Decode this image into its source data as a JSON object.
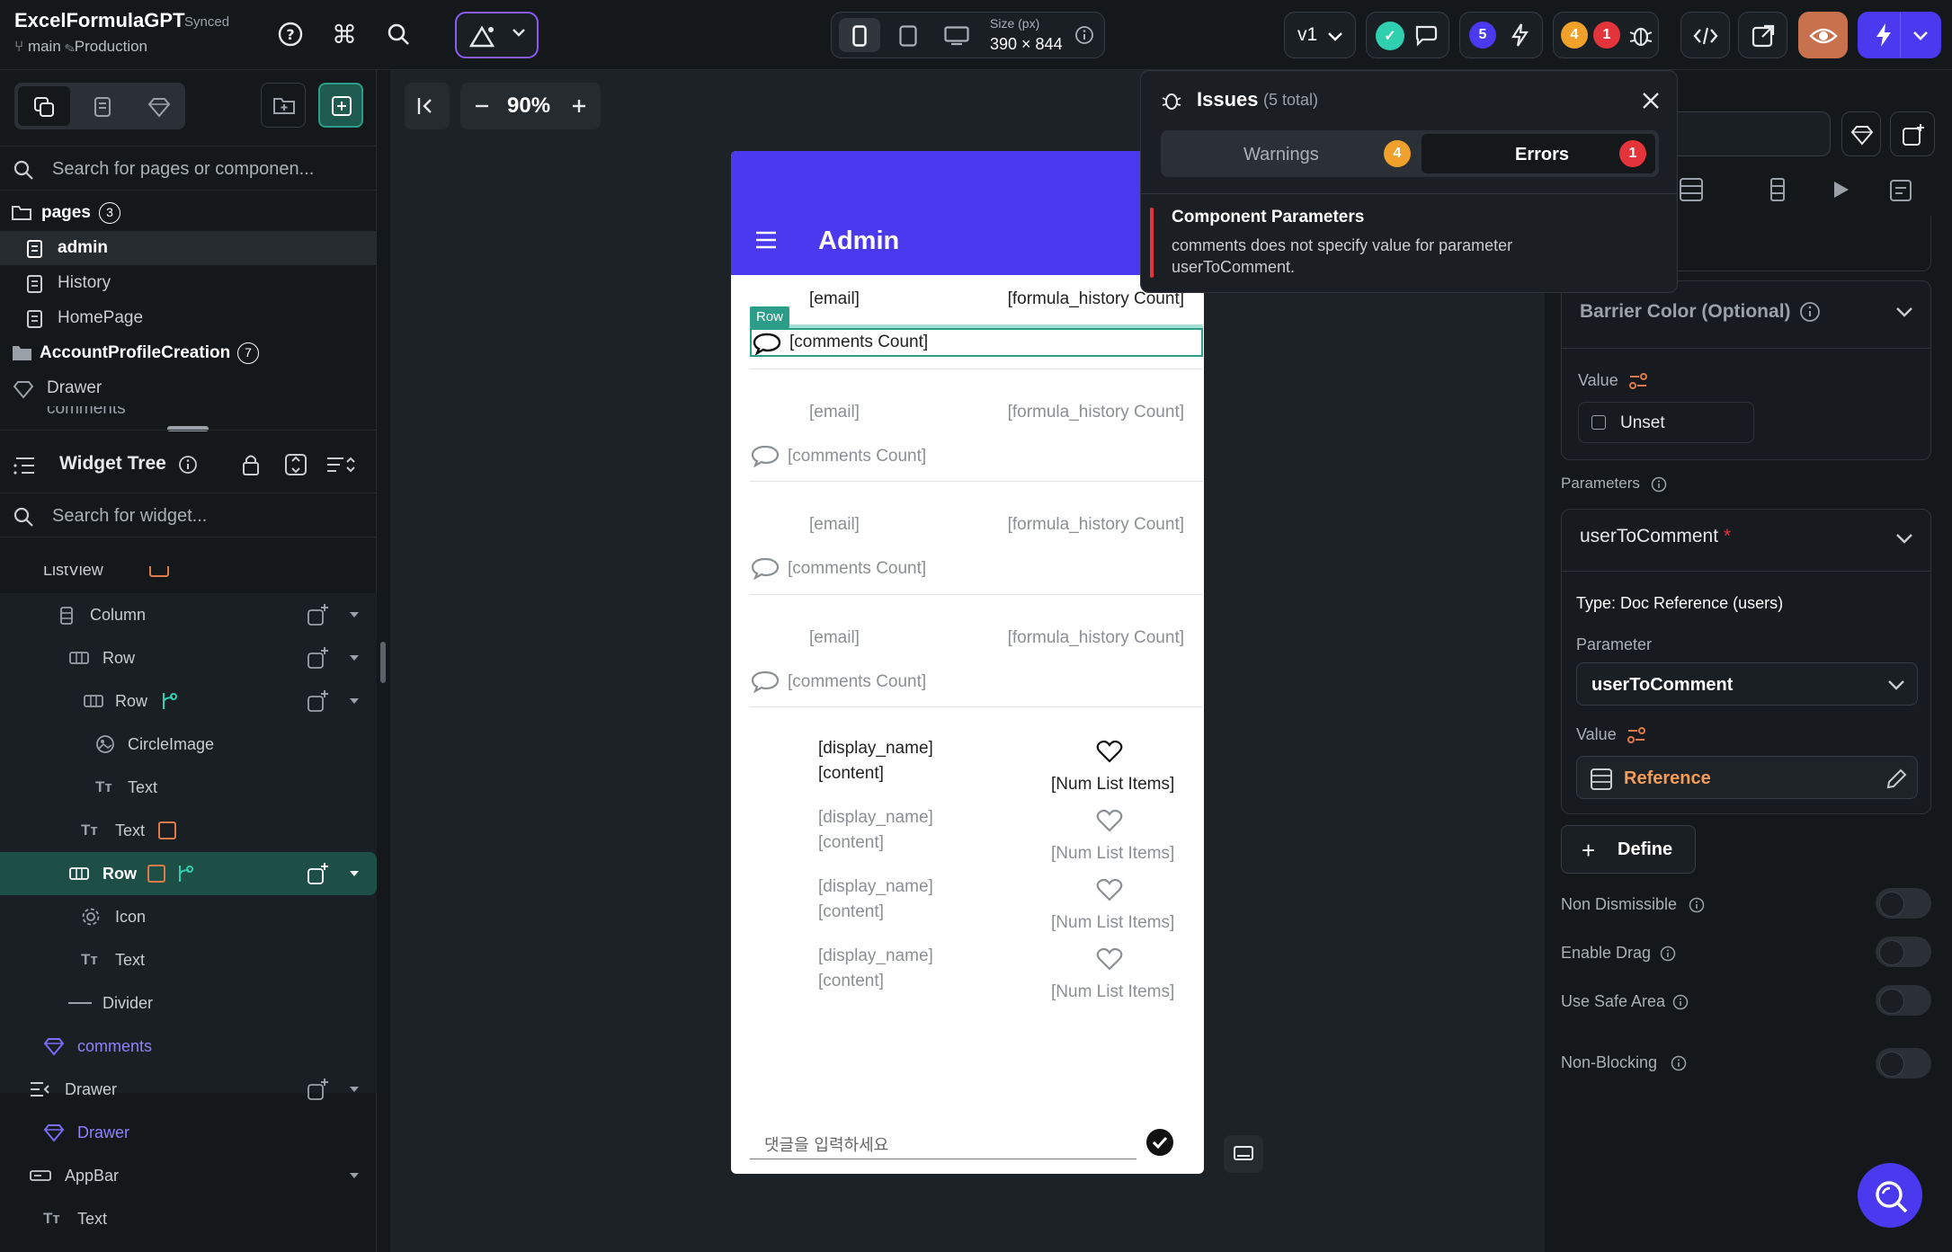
{
  "app": {
    "title": "ExcelFormulaGPT",
    "sync_status": "Synced",
    "branch": "main",
    "environment": "Production"
  },
  "device": {
    "size_label": "Size (px)",
    "size_value": "390 × 844"
  },
  "version": {
    "label": "v1"
  },
  "badges": {
    "collab": "5",
    "warnings": "4",
    "errors": "1"
  },
  "left": {
    "search_placeholder": "Search for pages or componen...",
    "pages_header": "pages",
    "pages_count": "3",
    "pages": [
      "admin",
      "History",
      "HomePage"
    ],
    "folder": "AccountProfileCreation",
    "folder_count": "7",
    "components": [
      "Drawer",
      "comments"
    ],
    "widget_tree_title": "Widget Tree",
    "widget_search_placeholder": "Search for widget...",
    "tree": {
      "listview": "ListView",
      "column": "Column",
      "row1": "Row",
      "row2": "Row",
      "circleimage": "CircleImage",
      "text1": "Text",
      "text2": "Text",
      "row_selected": "Row",
      "icon": "Icon",
      "text3": "Text",
      "divider": "Divider",
      "comments": "comments",
      "drawer": "Drawer",
      "drawer_comp": "Drawer",
      "appbar": "AppBar",
      "text4": "Text"
    }
  },
  "canvas": {
    "zoom": "90%"
  },
  "phone": {
    "appbar_title": "Admin",
    "selected_tag": "Row",
    "rows": [
      {
        "email": "[email]",
        "count": "[formula_history Count]",
        "comments": "[comments Count]"
      },
      {
        "email": "[email]",
        "count": "[formula_history Count]",
        "comments": "[comments Count]"
      },
      {
        "email": "[email]",
        "count": "[formula_history Count]",
        "comments": "[comments Count]"
      },
      {
        "email": "[email]",
        "count": "[formula_history Count]",
        "comments": "[comments Count]"
      }
    ],
    "comments": [
      {
        "name": "[display_name]",
        "content": "[content]",
        "items": "[Num List Items]"
      },
      {
        "name": "[display_name]",
        "content": "[content]",
        "items": "[Num List Items]"
      },
      {
        "name": "[display_name]",
        "content": "[content]",
        "items": "[Num List Items]"
      },
      {
        "name": "[display_name]",
        "content": "[content]",
        "items": "[Num List Items]"
      }
    ],
    "input_placeholder": "댓글을 입력하세요"
  },
  "issues": {
    "title": "Issues",
    "total": "(5 total)",
    "tab_warnings": "Warnings",
    "tab_errors": "Errors",
    "warnings_count": "4",
    "errors_count": "1",
    "item_title": "Component Parameters",
    "item_body_1": "comments does not specify value for parameter",
    "item_body_2": "userToComment."
  },
  "right": {
    "barrier_color": "Barrier Color (Optional)",
    "value_label": "Value",
    "unset_label": "Unset",
    "parameters_label": "Parameters",
    "param_name": "userToComment",
    "required_mark": "*",
    "type_label": "Type: Doc Reference (users)",
    "parameter_label": "Parameter",
    "parameter_value": "userToComment",
    "value_label2": "Value",
    "reference": "Reference",
    "define": "Define",
    "non_dismissible": "Non Dismissible",
    "enable_drag": "Enable Drag",
    "use_safe_area": "Use Safe Area",
    "non_blocking": "Non-Blocking"
  },
  "colors": {
    "accent": "#4b39ef",
    "warning": "#f0a12c",
    "error": "#e3343b",
    "teal": "#2c9d88",
    "reference": "#f39c5a"
  }
}
